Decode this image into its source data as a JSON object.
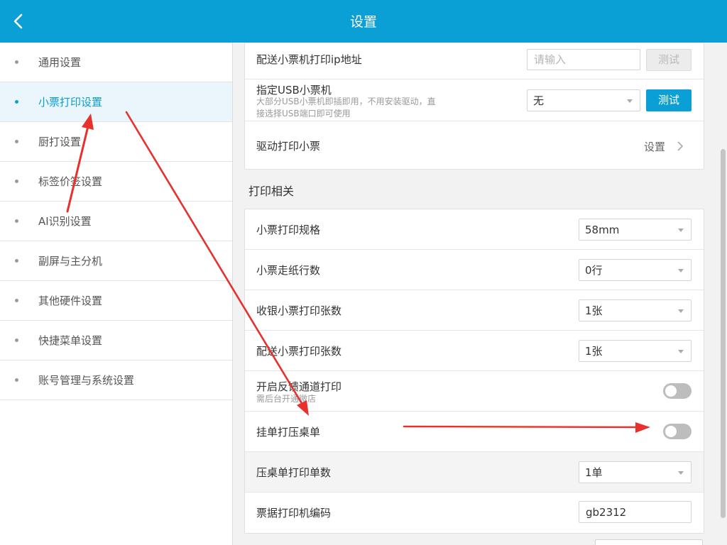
{
  "header": {
    "title": "设置",
    "back_icon": "chevron-left-icon"
  },
  "sidebar": {
    "items": [
      {
        "label": "通用设置",
        "active": false
      },
      {
        "label": "小票打印设置",
        "active": true
      },
      {
        "label": "厨打设置",
        "active": false
      },
      {
        "label": "标签价签设置",
        "active": false
      },
      {
        "label": "AI识别设置",
        "active": false
      },
      {
        "label": "副屏与主分机",
        "active": false
      },
      {
        "label": "其他硬件设置",
        "active": false
      },
      {
        "label": "快捷菜单设置",
        "active": false
      },
      {
        "label": "账号管理与系统设置",
        "active": false
      }
    ]
  },
  "printer_card": {
    "ip_row": {
      "label": "配送小票机打印ip地址",
      "placeholder": "请输入",
      "value": "",
      "test_label": "测试"
    },
    "usb_row": {
      "label": "指定USB小票机",
      "sub_line1": "大部分USB小票机即插即用，不用安装驱动，直",
      "sub_line2": "接选择USB端口即可使用",
      "select_value": "无",
      "test_label": "测试"
    },
    "driver_row": {
      "label": "驱动打印小票",
      "action_label": "设置"
    }
  },
  "print_section": {
    "title": "打印相关",
    "rows": {
      "spec": {
        "label": "小票打印规格",
        "value": "58mm"
      },
      "feed": {
        "label": "小票走纸行数",
        "value": "0行"
      },
      "cashier_copies": {
        "label": "收银小票打印张数",
        "value": "1张"
      },
      "delivery_copies": {
        "label": "配送小票打印张数",
        "value": "1张"
      },
      "feedback": {
        "label": "开启反馈通道打印",
        "sub": "需后台开通微店",
        "enabled": false
      },
      "hang_order": {
        "label": "挂单打压桌单",
        "enabled": false
      },
      "table_copies": {
        "label": "压桌单打印单数",
        "value": "1单"
      },
      "encoding": {
        "label": "票据打印机编码",
        "value": "gb2312"
      }
    }
  },
  "colors": {
    "accent": "#0aa0d6",
    "annotation": "#e8302d",
    "toggle_off": "#bdbdbd"
  }
}
